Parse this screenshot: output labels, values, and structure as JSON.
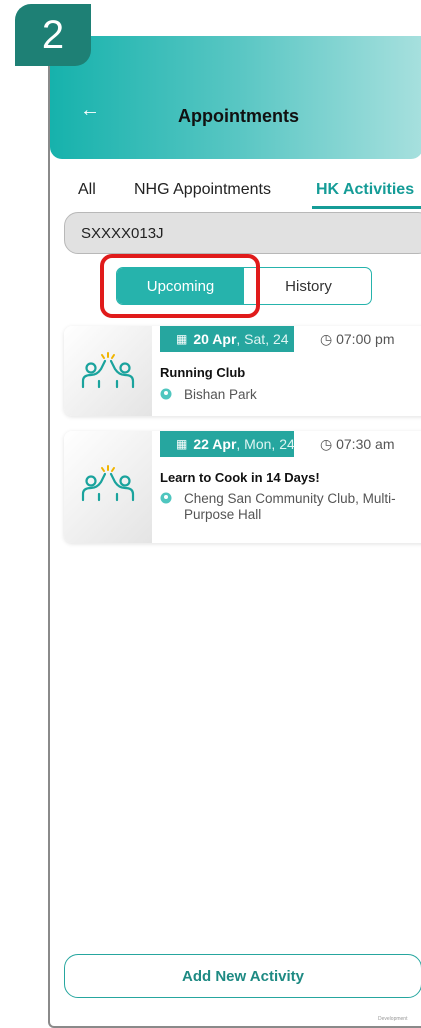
{
  "step_badge": "2",
  "header": {
    "title": "Appointments"
  },
  "tabs": [
    {
      "label": "All"
    },
    {
      "label": "NHG Appointments"
    },
    {
      "label": "HK Activities"
    }
  ],
  "search": {
    "value": "SXXXX013J"
  },
  "toggle": {
    "upcoming": "Upcoming",
    "history": "History"
  },
  "activities": [
    {
      "date_bold": "20 Apr",
      "date_rest": ", Sat, 24",
      "time": "07:00 pm",
      "title": "Running Club",
      "location": "Bishan Park"
    },
    {
      "date_bold": "22 Apr",
      "date_rest": ", Mon, 24",
      "time": "07:30 am",
      "title": "Learn to Cook in 14 Days!",
      "location": "Cheng San Community Club, Multi-Purpose Hall"
    }
  ],
  "add_button": "Add New Activity",
  "footer_note": "Development",
  "colors": {
    "accent": "#26a69f",
    "highlight": "#e01b1b",
    "badge": "#1e8075"
  }
}
